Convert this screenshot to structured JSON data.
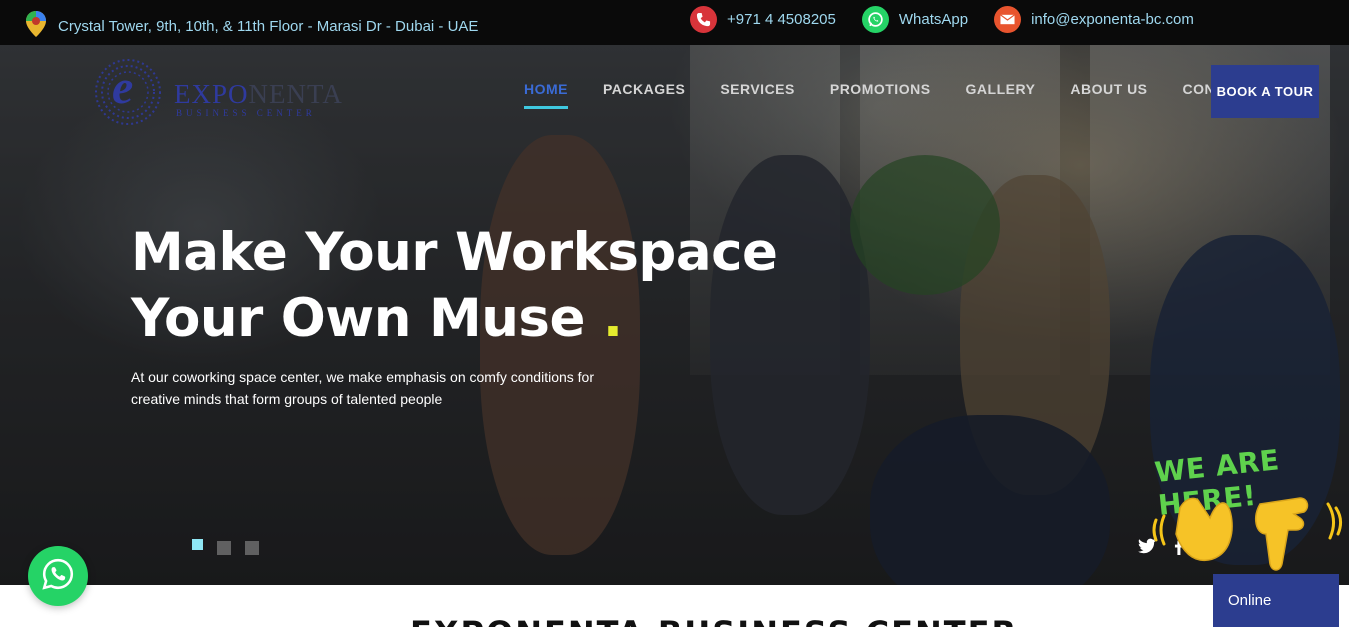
{
  "topbar": {
    "address": "Crystal Tower, 9th, 10th, & 11th Floor - Marasi Dr - Dubai - UAE",
    "phone": "+971 4 4508205",
    "whatsapp": "WhatsApp",
    "email": "info@exponenta-bc.com"
  },
  "logo": {
    "letter": "e",
    "brand_part1": "EXPO",
    "brand_part2": "NENTA",
    "subtitle": "BUSINESS CENTER"
  },
  "nav": {
    "items": [
      "HOME",
      "PACKAGES",
      "SERVICES",
      "PROMOTIONS",
      "GALLERY",
      "ABOUT US",
      "CONTACT US"
    ],
    "active_index": 0,
    "book_label": "BOOK A TOUR"
  },
  "hero": {
    "line1": "Make Your Workspace",
    "line2": "Your Own Muse",
    "dot": ".",
    "subtext": "At our coworking space center, we make emphasis on comfy conditions for creative minds that form groups of talented people",
    "slides": 3,
    "active_slide": 0
  },
  "widgets": {
    "we_are_here": "WE ARE HERE!",
    "online_label": "Online"
  },
  "section": {
    "title": "EXPONENTA BUSINESS CENTER"
  },
  "colors": {
    "topbar_bg": "#0a0a0a",
    "topbar_text": "#9fd8ef",
    "brand_blue": "#2c3d8f",
    "active_underline": "#3fc8df",
    "accent_dot": "#e5ec2e",
    "whatsapp_green": "#25d366",
    "we_here_green": "#5fd24d"
  },
  "icons": {
    "location": "map-pin-icon",
    "phone": "phone-icon",
    "whatsapp": "whatsapp-icon",
    "email": "envelope-icon",
    "twitter": "twitter-icon",
    "facebook": "facebook-icon",
    "hands": "waving-hands-icon"
  }
}
